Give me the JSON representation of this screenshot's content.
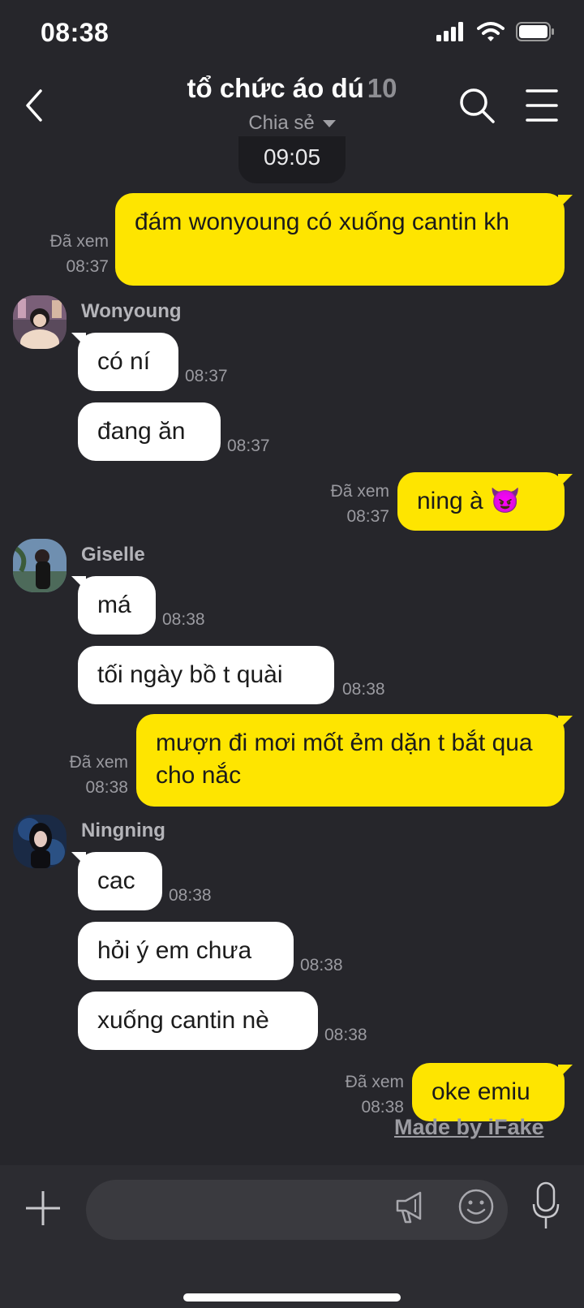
{
  "status_bar": {
    "time": "08:38"
  },
  "header": {
    "title": "tổ chức áo dú",
    "member_count": "10",
    "subtitle": "Chia sẻ"
  },
  "date_divider": "09:05",
  "messages": [
    {
      "from": "me",
      "text": "đám wonyoung có xuống cantin kh",
      "read": "Đã xem",
      "time": "08:37"
    },
    {
      "from": "Wonyoung",
      "sender": "Wonyoung",
      "text": "có ní",
      "time": "08:37"
    },
    {
      "from": "Wonyoung",
      "text": "đang ăn",
      "time": "08:37"
    },
    {
      "from": "me",
      "text": "ning à 😈",
      "read": "Đã xem",
      "time": "08:37"
    },
    {
      "from": "Giselle",
      "sender": "Giselle",
      "text": "má",
      "time": "08:38"
    },
    {
      "from": "Giselle",
      "text": "tối ngày bồ t quài",
      "time": "08:38"
    },
    {
      "from": "me",
      "text": "mượn đi mơi mốt ẻm dặn t bắt qua cho nắc",
      "read": "Đã xem",
      "time": "08:38"
    },
    {
      "from": "Ningning",
      "sender": "Ningning",
      "text": "cac",
      "time": "08:38"
    },
    {
      "from": "Ningning",
      "text": "hỏi ý em chưa",
      "time": "08:38"
    },
    {
      "from": "Ningning",
      "text": "xuống cantin nè",
      "time": "08:38"
    },
    {
      "from": "me",
      "text": "oke emiu",
      "read": "Đã xem",
      "time": "08:38"
    }
  ],
  "watermark": "Made by iFake",
  "input": {
    "placeholder": ""
  },
  "colors": {
    "background": "#26262b",
    "my_bubble": "#fee500",
    "their_bubble": "#ffffff",
    "meta_text": "#9a9aa0"
  }
}
